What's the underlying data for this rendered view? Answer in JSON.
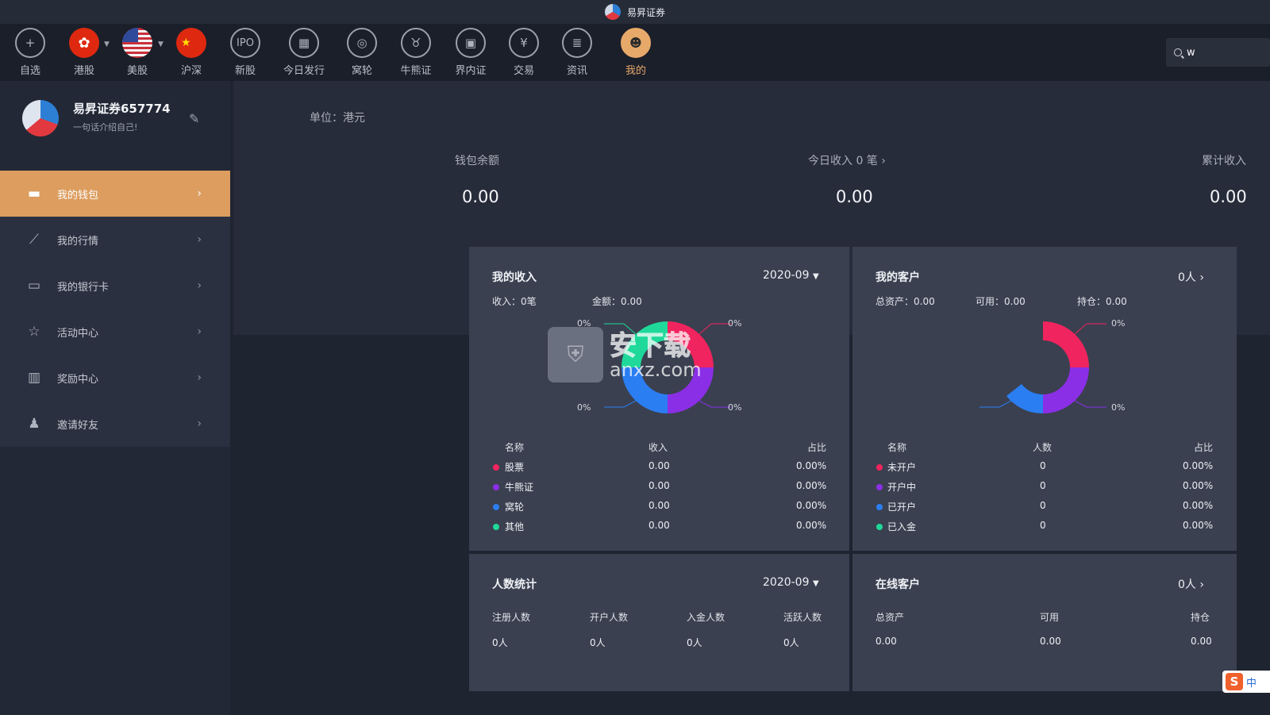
{
  "app": {
    "title": "易昇证券"
  },
  "toolbar": {
    "items": [
      {
        "label": "自选",
        "icon": "add-icon"
      },
      {
        "label": "港股",
        "icon": "hk-flag-icon"
      },
      {
        "label": "美股",
        "icon": "us-flag-icon"
      },
      {
        "label": "沪深",
        "icon": "cn-flag-icon"
      },
      {
        "label": "新股",
        "icon": "ipo-icon",
        "text": "IPO"
      },
      {
        "label": "今日发行",
        "icon": "calendar-icon"
      },
      {
        "label": "窝轮",
        "icon": "warrant-icon"
      },
      {
        "label": "牛熊证",
        "icon": "bull-icon"
      },
      {
        "label": "界内证",
        "icon": "chart-icon"
      },
      {
        "label": "交易",
        "icon": "yen-icon",
        "text": "¥"
      },
      {
        "label": "资讯",
        "icon": "news-icon"
      },
      {
        "label": "我的",
        "icon": "user-icon",
        "active": true
      }
    ]
  },
  "search": {
    "value": "w"
  },
  "profile": {
    "name": "易昇证券657774",
    "bio": "一句话介绍自己!"
  },
  "menu": [
    {
      "label": "我的钱包",
      "icon": "wallet-icon",
      "active": true
    },
    {
      "label": "我的行情",
      "icon": "trend-icon"
    },
    {
      "label": "我的银行卡",
      "icon": "bank-card-icon"
    },
    {
      "label": "活动中心",
      "icon": "activity-icon"
    },
    {
      "label": "奖励中心",
      "icon": "gift-icon"
    },
    {
      "label": "邀请好友",
      "icon": "invite-icon"
    }
  ],
  "main": {
    "unit": "单位：港元",
    "stats": [
      {
        "label": "钱包余额",
        "value": "0.00"
      },
      {
        "label": "今日收入 0 笔",
        "value": "0.00"
      },
      {
        "label": "累计收入",
        "value": "0.00"
      }
    ]
  },
  "income": {
    "title": "我的收入",
    "period": "2020-09",
    "count": "收入：0笔",
    "amount": "金额：0.00",
    "pcts": [
      "0%",
      "0%",
      "0%",
      "0%"
    ],
    "headers": [
      "名称",
      "收入",
      "占比"
    ],
    "rows": [
      {
        "name": "股票",
        "value": "0.00",
        "pct": "0.00%",
        "color": "#f0245e"
      },
      {
        "name": "牛熊证",
        "value": "0.00",
        "pct": "0.00%",
        "color": "#8b2fe6"
      },
      {
        "name": "窝轮",
        "value": "0.00",
        "pct": "0.00%",
        "color": "#2b7ef2"
      },
      {
        "name": "其他",
        "value": "0.00",
        "pct": "0.00%",
        "color": "#1fd99a"
      }
    ]
  },
  "clients": {
    "title": "我的客户",
    "count": "0人",
    "total": "总资产：0.00",
    "avail": "可用：0.00",
    "hold": "持仓：0.00",
    "pcts": [
      "0%",
      "0%"
    ],
    "headers": [
      "名称",
      "人数",
      "占比"
    ],
    "rows": [
      {
        "name": "未开户",
        "value": "0",
        "pct": "0.00%",
        "color": "#f0245e"
      },
      {
        "name": "开户中",
        "value": "0",
        "pct": "0.00%",
        "color": "#8b2fe6"
      },
      {
        "name": "已开户",
        "value": "0",
        "pct": "0.00%",
        "color": "#2b7ef2"
      },
      {
        "name": "已入金",
        "value": "0",
        "pct": "0.00%",
        "color": "#1fd99a"
      }
    ]
  },
  "people": {
    "title": "人数统计",
    "period": "2020-09",
    "headers": [
      "注册人数",
      "开户人数",
      "入金人数",
      "活跃人数"
    ],
    "values": [
      "0人",
      "0人",
      "0人",
      "0人"
    ]
  },
  "online": {
    "title": "在线客户",
    "count": "0人",
    "headers": [
      "总资产",
      "可用",
      "持仓"
    ],
    "values": [
      "0.00",
      "0.00",
      "0.00"
    ]
  },
  "watermark": {
    "text": "安下载",
    "domain": "anxz.com"
  },
  "ime": {
    "lang": "中"
  }
}
